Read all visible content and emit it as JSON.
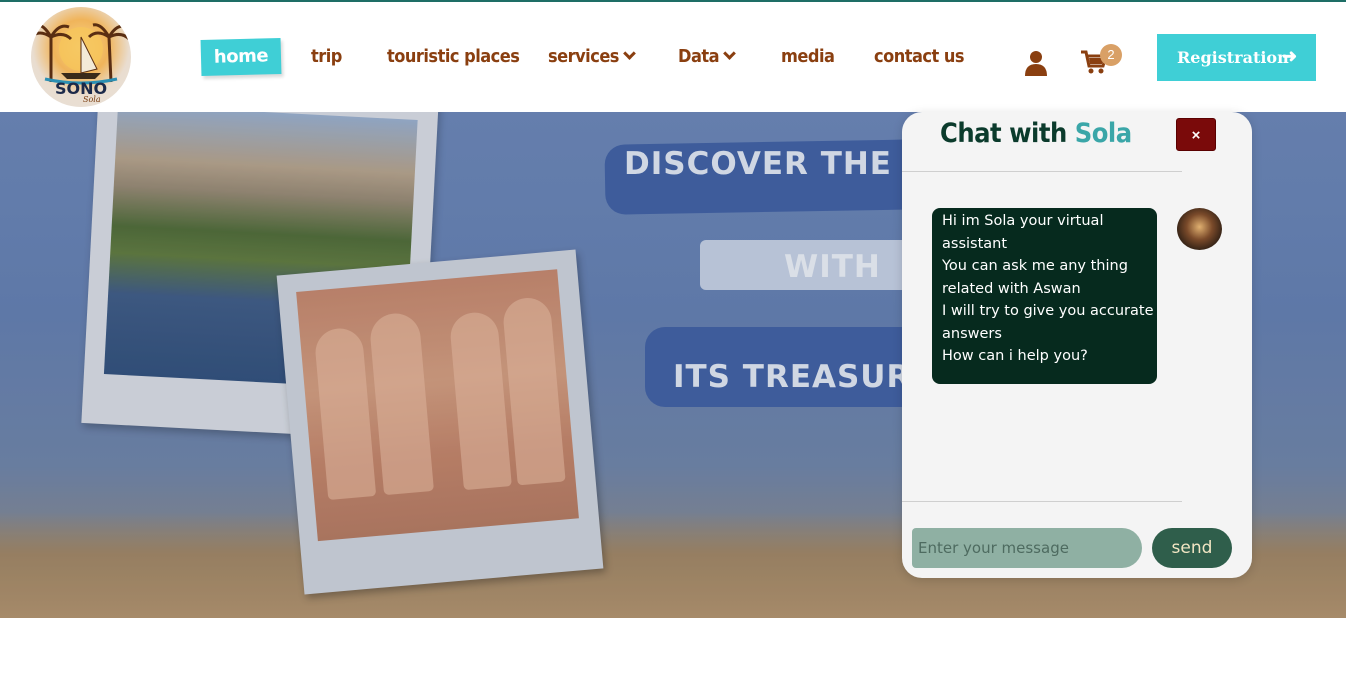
{
  "brand": {
    "logo_text": "SONO",
    "logo_sub": "Sola"
  },
  "nav": {
    "items": [
      {
        "label": "home",
        "active": true
      },
      {
        "label": "trip"
      },
      {
        "label": "touristic places"
      },
      {
        "label": "services",
        "dropdown": true
      },
      {
        "label": "Data",
        "dropdown": true
      },
      {
        "label": "media"
      },
      {
        "label": "contact us"
      }
    ],
    "cart_count": "2",
    "registration_label": "Registration"
  },
  "hero": {
    "line1": "DISCOVER THE LAN",
    "line2": "WITH",
    "line3": "ITS TREASURED"
  },
  "chat": {
    "title_prefix": "Chat with",
    "title_name": "Sola",
    "close_label": "×",
    "message_lines": [
      "Hi im Sola your virtual",
      "assistant",
      "You can ask me any thing",
      "related with Aswan",
      "I will try to give you accurate",
      "answers",
      "How can i help you?"
    ],
    "input_placeholder": "Enter your message",
    "send_label": "send"
  },
  "colors": {
    "accent": "#3fcfd6",
    "nav_text": "#8a3f10",
    "chat_bubble": "#062a1e",
    "close_button": "#7a0a0a",
    "send_button": "#2f5e4b"
  }
}
